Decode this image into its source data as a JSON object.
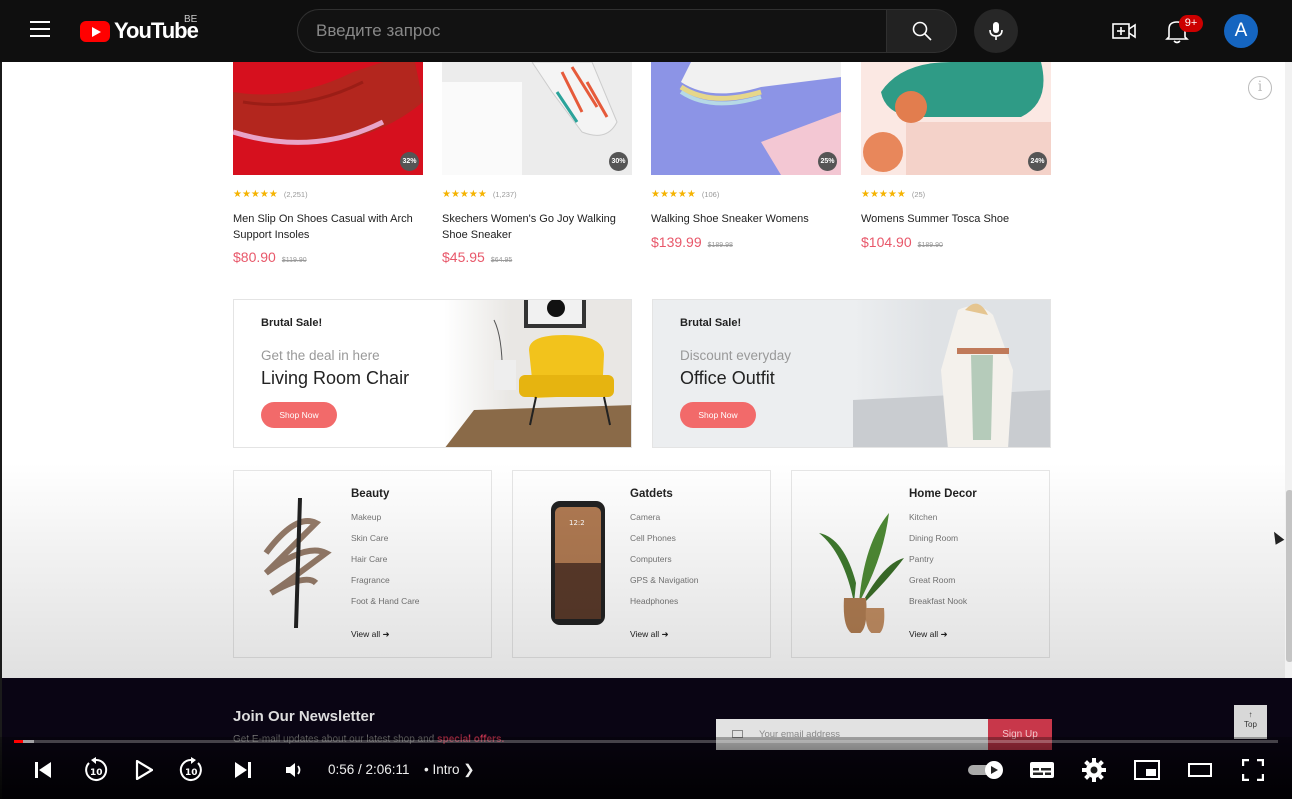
{
  "youtube": {
    "logo_text": "YouTube",
    "region": "BE",
    "search_placeholder": "Введите запрос",
    "notification_count": "9+",
    "avatar_letter": "A"
  },
  "products": [
    {
      "rating": "★★★★★",
      "reviews": "(2,251)",
      "name": "Men Slip On Shoes Casual with Arch Support Insoles",
      "price": "$80.90",
      "old_price": "$119.90",
      "discount": "32%"
    },
    {
      "rating": "★★★★★",
      "reviews": "(1,237)",
      "name": "Skechers Women's Go Joy Walking Shoe Sneaker",
      "price": "$45.95",
      "old_price": "$64.95",
      "discount": "30%"
    },
    {
      "rating": "★★★★★",
      "reviews": "(106)",
      "name": "Walking Shoe Sneaker Womens",
      "price": "$139.99",
      "old_price": "$189.98",
      "discount": "25%"
    },
    {
      "rating": "★★★★★",
      "reviews": "(25)",
      "name": "Womens Summer Tosca Shoe",
      "price": "$104.90",
      "old_price": "$189.90",
      "discount": "24%"
    }
  ],
  "banners": [
    {
      "tag": "Brutal Sale!",
      "subtitle": "Get the deal in here",
      "heading": "Living Room Chair",
      "button": "Shop Now"
    },
    {
      "tag": "Brutal Sale!",
      "subtitle": "Discount everyday",
      "heading": "Office Outfit",
      "button": "Shop Now"
    }
  ],
  "categories": [
    {
      "title": "Beauty",
      "items": [
        "Makeup",
        "Skin Care",
        "Hair Care",
        "Fragrance",
        "Foot & Hand Care"
      ],
      "view_all": "View all"
    },
    {
      "title": "Gatdets",
      "items": [
        "Camera",
        "Cell Phones",
        "Computers",
        "GPS & Navigation",
        "Headphones"
      ],
      "view_all": "View all"
    },
    {
      "title": "Home Decor",
      "items": [
        "Kitchen",
        "Dining Room",
        "Pantry",
        "Great Room",
        "Breakfast Nook"
      ],
      "view_all": "View all"
    }
  ],
  "newsletter": {
    "title": "Join Our Newsletter",
    "subtitle_prefix": "Get E-mail updates about our latest shop and",
    "subtitle_highlight": "special offers.",
    "email_placeholder": "Your email address",
    "button": "Sign Up",
    "top_label": "Top"
  },
  "player": {
    "time": "0:56 / 2:06:11",
    "chapter": "• Intro",
    "played_fraction": 0.007,
    "loaded_fraction": 0.016
  },
  "colors": {
    "youtube_red": "#ff0000",
    "price_pink": "#e8586a",
    "star_yellow": "#f5b301",
    "shop_btn": "#f26a6a"
  }
}
